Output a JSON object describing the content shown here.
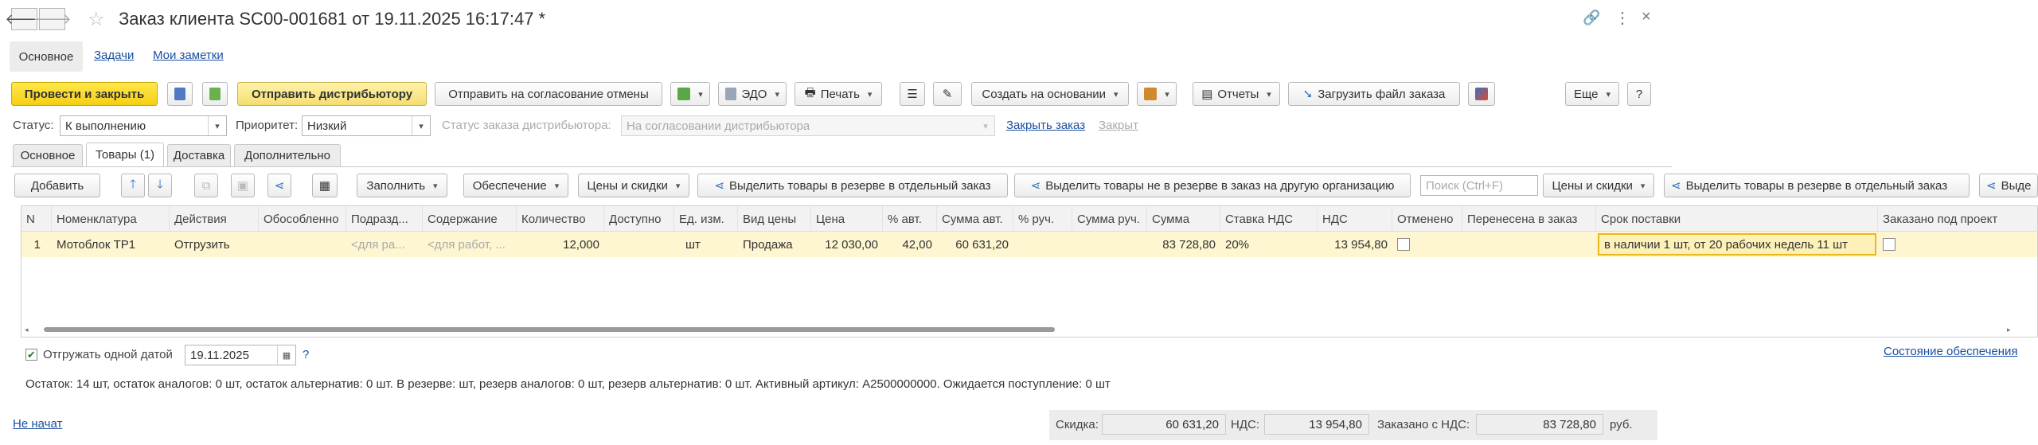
{
  "window": {
    "title": "Заказ клиента SC00-001681 от 19.11.2025 16:17:47 *"
  },
  "nav_tabs": [
    "Основное",
    "Задачи",
    "Мои заметки"
  ],
  "toolbar": {
    "post_close": "Провести и закрыть",
    "send_distributor": "Отправить дистрибьютору",
    "send_cancel": "Отправить на согласование отмены",
    "edo": "ЭДО",
    "print": "Печать",
    "create_based": "Создать на основании",
    "reports": "Отчеты",
    "load_file": "Загрузить файл заказа",
    "more": "Еще",
    "help": "?"
  },
  "status_row": {
    "status_label": "Статус:",
    "status_value": "К выполнению",
    "priority_label": "Приоритет:",
    "priority_value": "Низкий",
    "dist_status_label": "Статус заказа дистрибьютора:",
    "dist_status_value": "На согласовании дистрибьютора",
    "close_order_link": "Закрыть заказ",
    "closed_label": "Закрыт"
  },
  "doc_tabs": [
    "Основное",
    "Товары (1)",
    "Доставка",
    "Дополнительно"
  ],
  "goods_toolbar": {
    "add": "Добавить",
    "fill": "Заполнить",
    "provision": "Обеспечение",
    "prices": "Цены и скидки",
    "reserve_separate": "Выделить товары в резерве в отдельный заказ",
    "not_reserve_other": "Выделить товары не в резерве в заказ на другую организацию",
    "search_placeholder": "Поиск (Ctrl+F)",
    "prices2": "Цены и скидки",
    "reserve_separate2": "Выделить товары в резерве в отдельный заказ",
    "cut_label": "Выде"
  },
  "table": {
    "columns": [
      "N",
      "Номенклатура",
      "Действия",
      "Обособленно",
      "Подразд...",
      "Содержание",
      "Количество",
      "Доступно",
      "Ед. изм.",
      "Вид цены",
      "Цена",
      "% авт.",
      "Сумма авт.",
      "% руч.",
      "Сумма руч.",
      "Сумма",
      "Ставка НДС",
      "НДС",
      "Отменено",
      "Перенесена в заказ",
      "Срок поставки",
      "Заказано под проект"
    ],
    "rows": [
      {
        "n": "1",
        "item": "Мотоблок ТР1",
        "action": "Отгрузить",
        "separate": "",
        "dept": "<для ра...",
        "content": "<для работ, ...",
        "qty": "12,000",
        "available": "",
        "unit": "шт",
        "price_type": "Продажа",
        "price": "12 030,00",
        "pct_auto": "42,00",
        "sum_auto": "60 631,20",
        "pct_manual": "",
        "sum_manual": "",
        "sum": "83 728,80",
        "vat_rate": "20%",
        "vat": "13 954,80",
        "cancelled": false,
        "moved": "",
        "delivery": "в наличии 1 шт, от 20 рабочих недель 11 шт",
        "project": false
      }
    ]
  },
  "below_table": {
    "ship_one_date_label": "Отгружать одной датой",
    "ship_date": "19.11.2025",
    "help": "?",
    "provision_state_link": "Состояние обеспечения",
    "info_line": "Остаток: 14 шт, остаток аналогов: 0 шт, остаток альтернатив: 0 шт. В резерве:  шт, резерв аналогов: 0 шт, резерв альтернатив: 0 шт. Активный артикул: A2500000000. Ожидается поступление: 0 шт"
  },
  "footer": {
    "state_link": "Не начат",
    "discount_label": "Скидка:",
    "discount_value": "60 631,20",
    "vat_label": "НДС:",
    "vat_value": "13 954,80",
    "ordered_label": "Заказано с НДС:",
    "ordered_value": "83 728,80",
    "currency": "руб."
  }
}
